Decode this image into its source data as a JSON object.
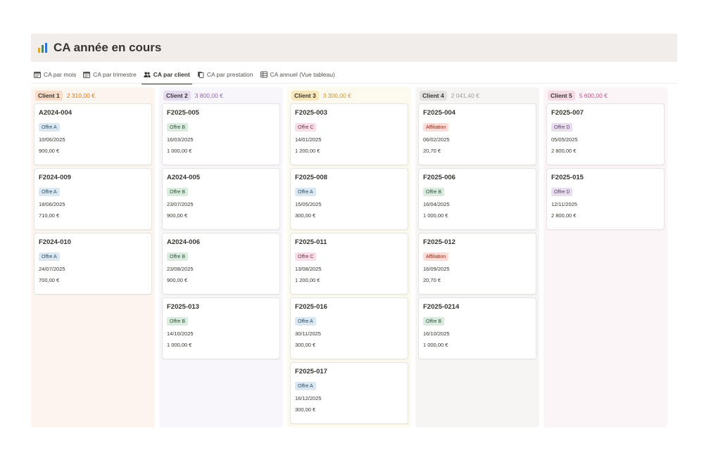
{
  "page": {
    "title": "CA année en cours"
  },
  "tabs": [
    {
      "label": "CA par mois",
      "icon": "calendar-icon",
      "active": false
    },
    {
      "label": "CA par trimestre",
      "icon": "calendar-icon",
      "active": false
    },
    {
      "label": "CA par client",
      "icon": "people-icon",
      "active": true
    },
    {
      "label": "CA par prestation",
      "icon": "pages-icon",
      "active": false
    },
    {
      "label": "CA annuel (Vue tableau)",
      "icon": "table-icon",
      "active": false
    }
  ],
  "columns": [
    {
      "label": "Client 1",
      "total": "2 310,00 €",
      "col_bg": "#fcf4ef",
      "tag_bg": "#f8dcc8",
      "sum_color": "#d9730d",
      "cards": [
        {
          "title": "A2024-004",
          "offer": "Offre A",
          "offer_style": "blue",
          "date": "10/06/2025",
          "amount": "900,00 €"
        },
        {
          "title": "F2024-009",
          "offer": "Offre A",
          "offer_style": "blue",
          "date": "18/06/2025",
          "amount": "710,00 €"
        },
        {
          "title": "F2024-010",
          "offer": "Offre A",
          "offer_style": "blue",
          "date": "24/07/2025",
          "amount": "700,00 €"
        }
      ]
    },
    {
      "label": "Client 2",
      "total": "3 800,00 €",
      "col_bg": "#f8f5fb",
      "tag_bg": "#e5dbf1",
      "sum_color": "#9065b0",
      "cards": [
        {
          "title": "F2025-005",
          "offer": "Offre B",
          "offer_style": "green",
          "date": "16/03/2025",
          "amount": "1 000,00 €"
        },
        {
          "title": "A2024-005",
          "offer": "Offre B",
          "offer_style": "green",
          "date": "23/07/2025",
          "amount": "900,00 €"
        },
        {
          "title": "A2024-006",
          "offer": "Offre B",
          "offer_style": "green",
          "date": "23/08/2025",
          "amount": "900,00 €"
        },
        {
          "title": "F2025-013",
          "offer": "Offre B",
          "offer_style": "green",
          "date": "14/10/2025",
          "amount": "1 000,00 €"
        }
      ]
    },
    {
      "label": "Client 3",
      "total": "3 300,00 €",
      "col_bg": "#fcf9ef",
      "tag_bg": "#f9e6b9",
      "sum_color": "#cb912f",
      "cards": [
        {
          "title": "F2025-003",
          "offer": "Offre C",
          "offer_style": "pink",
          "date": "14/01/2025",
          "amount": "1 200,00 €"
        },
        {
          "title": "F2025-008",
          "offer": "Offre A",
          "offer_style": "blue",
          "date": "15/05/2025",
          "amount": "300,00 €"
        },
        {
          "title": "F2025-011",
          "offer": "Offre C",
          "offer_style": "pink",
          "date": "13/08/2025",
          "amount": "1 200,00 €"
        },
        {
          "title": "F2025-016",
          "offer": "Offre A",
          "offer_style": "blue",
          "date": "30/11/2025",
          "amount": "300,00 €"
        },
        {
          "title": "F2025-017",
          "offer": "Offre A",
          "offer_style": "blue",
          "date": "16/12/2025",
          "amount": "300,00 €"
        }
      ]
    },
    {
      "label": "Client 4",
      "total": "2 041,40 €",
      "col_bg": "#f6f5f4",
      "tag_bg": "#e3e2e0",
      "sum_color": "#9b9a97",
      "cards": [
        {
          "title": "F2025-004",
          "offer": "Affiliation",
          "offer_style": "red",
          "date": "06/02/2025",
          "amount": "20,70 €"
        },
        {
          "title": "F2025-006",
          "offer": "Offre B",
          "offer_style": "green",
          "date": "16/04/2025",
          "amount": "1 000,00 €"
        },
        {
          "title": "F2025-012",
          "offer": "Affiliation",
          "offer_style": "red",
          "date": "16/09/2025",
          "amount": "20,70 €"
        },
        {
          "title": "F2025-0214",
          "offer": "Offre B",
          "offer_style": "green",
          "date": "16/10/2025",
          "amount": "1 000,00 €"
        }
      ]
    },
    {
      "label": "Client 5",
      "total": "5 600,00 €",
      "col_bg": "#fcf5f8",
      "tag_bg": "#f5dae6",
      "sum_color": "#c14c8a",
      "cards": [
        {
          "title": "F2025-007",
          "offer": "Offre D",
          "offer_style": "purple",
          "date": "05/05/2025",
          "amount": "2 800,00 €"
        },
        {
          "title": "F2025-015",
          "offer": "Offre D",
          "offer_style": "purple",
          "date": "12/11/2025",
          "amount": "2 800,00 €"
        }
      ]
    }
  ],
  "offer_styles": {
    "blue": {
      "bg": "#dbe7f1",
      "fg": "#1f4f74"
    },
    "green": {
      "bg": "#dcebdf",
      "fg": "#1e5a31"
    },
    "pink": {
      "bg": "#f8dde7",
      "fg": "#7a2850"
    },
    "red": {
      "bg": "#fbdcd6",
      "fg": "#8a2a1a"
    },
    "purple": {
      "bg": "#e8deee",
      "fg": "#5a3d75"
    }
  },
  "colors": {
    "chart_icon_bars": [
      "#e2a53a",
      "#3c8f5a",
      "#2f6fd0"
    ]
  }
}
